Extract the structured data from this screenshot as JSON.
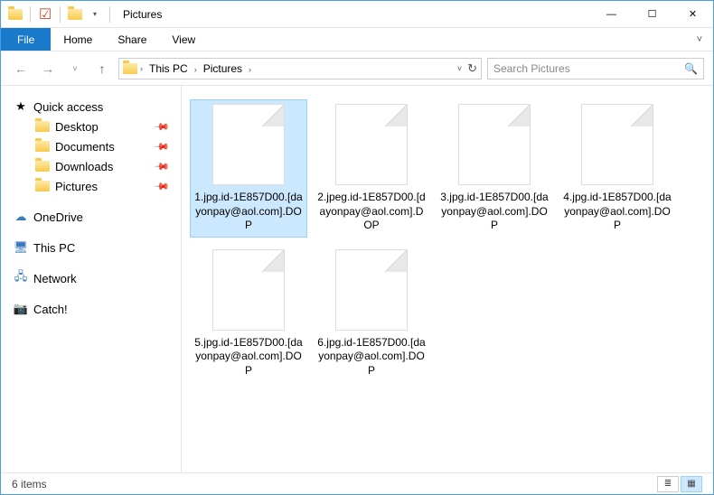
{
  "titlebar": {
    "title": "Pictures"
  },
  "ribbon": {
    "file": "File",
    "tabs": [
      "Home",
      "Share",
      "View"
    ]
  },
  "address": {
    "segments": [
      "This PC",
      "Pictures"
    ]
  },
  "search": {
    "placeholder": "Search Pictures"
  },
  "sidebar": {
    "quick_access": "Quick access",
    "quick_items": [
      {
        "label": "Desktop",
        "pinned": true
      },
      {
        "label": "Documents",
        "pinned": true
      },
      {
        "label": "Downloads",
        "pinned": true
      },
      {
        "label": "Pictures",
        "pinned": true
      }
    ],
    "roots": [
      {
        "label": "OneDrive"
      },
      {
        "label": "This PC"
      },
      {
        "label": "Network"
      },
      {
        "label": "Catch!"
      }
    ]
  },
  "files": [
    {
      "name": "1.jpg.id-1E857D00.[dayonpay@aol.com].DOP",
      "selected": true
    },
    {
      "name": "2.jpeg.id-1E857D00.[dayonpay@aol.com].DOP",
      "selected": false
    },
    {
      "name": "3.jpg.id-1E857D00.[dayonpay@aol.com].DOP",
      "selected": false
    },
    {
      "name": "4.jpg.id-1E857D00.[dayonpay@aol.com].DOP",
      "selected": false
    },
    {
      "name": "5.jpg.id-1E857D00.[dayonpay@aol.com].DOP",
      "selected": false
    },
    {
      "name": "6.jpg.id-1E857D00.[dayonpay@aol.com].DOP",
      "selected": false
    }
  ],
  "status": {
    "count_text": "6 items"
  }
}
